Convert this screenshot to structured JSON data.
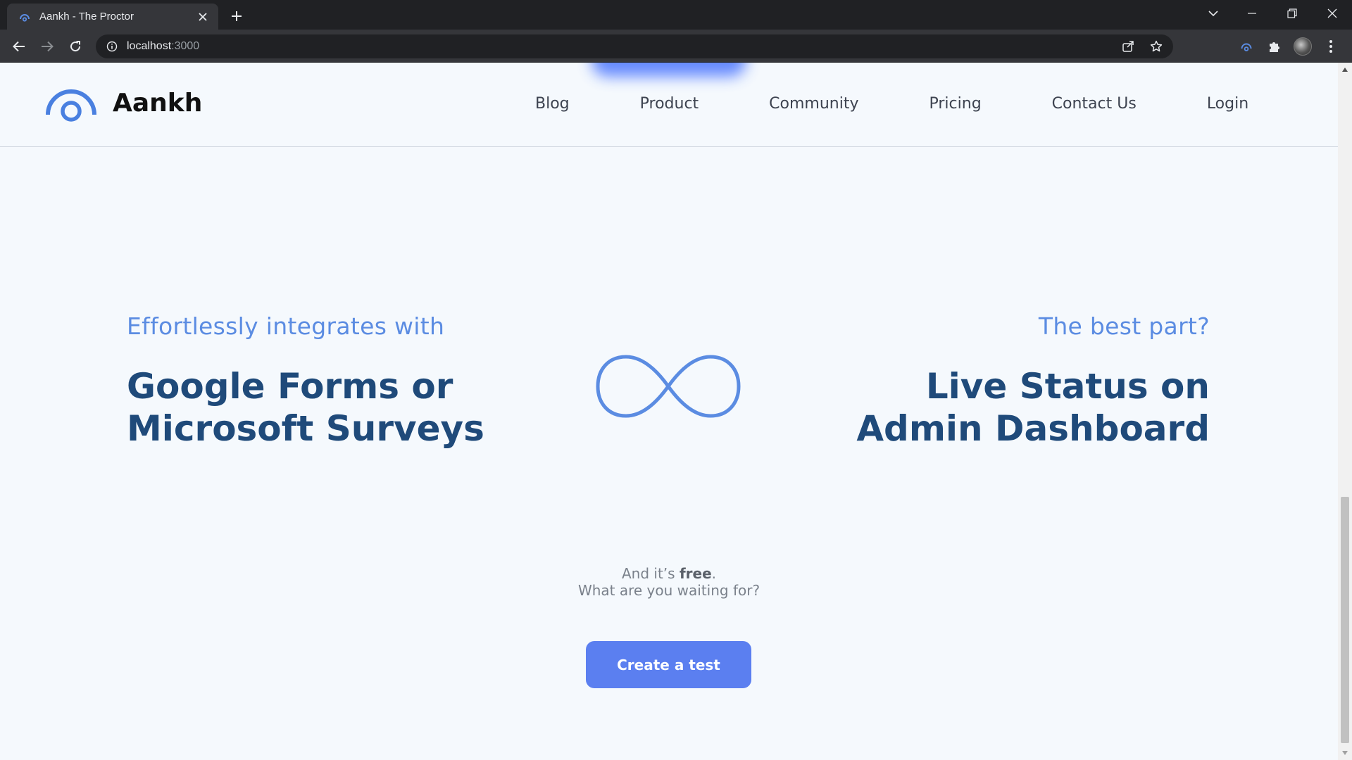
{
  "browser": {
    "tab_title": "Aankh - The Proctor",
    "url_host": "localhost",
    "url_port": ":3000"
  },
  "site": {
    "brand": "Aankh",
    "nav": [
      "Blog",
      "Product",
      "Community",
      "Pricing",
      "Contact Us",
      "Login"
    ]
  },
  "integration": {
    "kicker": "Effortlessly integrates with",
    "headline_line1": "Google Forms or",
    "headline_line2": "Microsoft Surveys"
  },
  "feature": {
    "kicker": "The best part?",
    "headline_line1": "Live Status on",
    "headline_line2": "Admin Dashboard"
  },
  "cta": {
    "line1_prefix": "And it’s ",
    "line1_bold": "free",
    "line1_suffix": ".",
    "line2": "What are you waiting for?",
    "button": "Create a test"
  },
  "colors": {
    "accent": "#5b8ce2",
    "headline": "#1f4a7a",
    "button": "#5b7ff0"
  },
  "icons": {
    "logo": "aankh-eye-logo",
    "center": "infinity-icon"
  }
}
